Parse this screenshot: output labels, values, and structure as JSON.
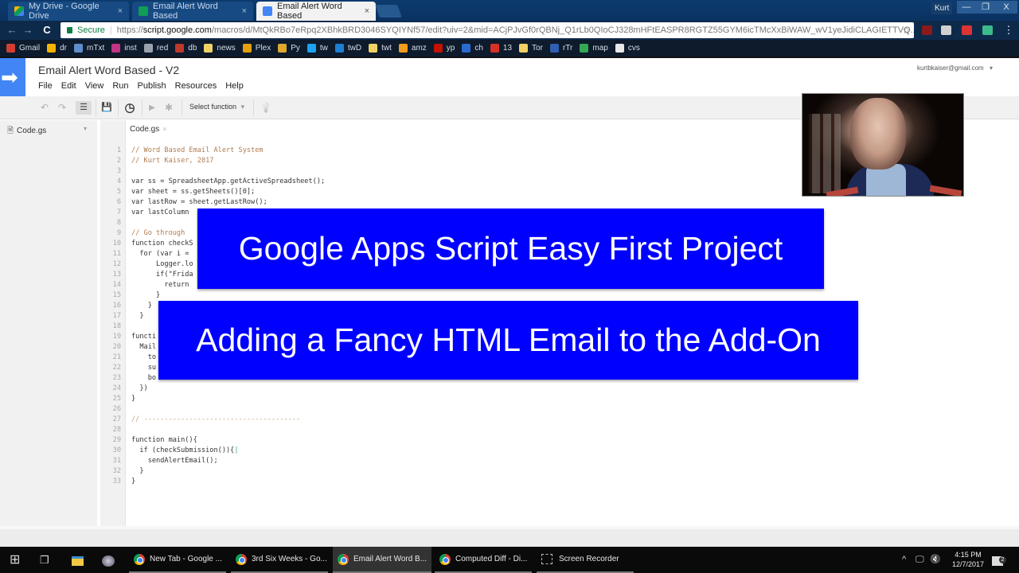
{
  "browser": {
    "tabs": [
      {
        "label": "My Drive - Google Drive",
        "icon": "google-drive-icon",
        "active": false
      },
      {
        "label": "Email Alert Word Based",
        "icon": "google-sheets-icon",
        "active": false
      },
      {
        "label": "Email Alert Word Based",
        "icon": "apps-script-icon",
        "active": true
      }
    ],
    "close_glyph": "×",
    "window_user": "Kurt",
    "window_controls": {
      "minimize": "—",
      "maximize": "❐",
      "close": "X"
    },
    "nav": {
      "back": "←",
      "forward": "→",
      "reload": "C"
    },
    "url": {
      "secure_label": "Secure",
      "scheme": "https://",
      "host": "script.google.com",
      "path": "/macros/d/MtQkRBo7eRpq2XBhkBRD3046SYQIYNf57/edit?uiv=2&mid=ACjPJvGf0rQBNj_Q1rLb0QIoCJ328mHFtEASPR8RGTZ55GYM6icTMcXxBiWAW_wV1yeJidiCLAGIETTVQ..."
    },
    "star": "☆",
    "menu_dots": "⋮",
    "bookmarks": [
      {
        "label": "Gmail",
        "color": "#d23f31"
      },
      {
        "label": "dr",
        "color": "#f4b400"
      },
      {
        "label": "mTxt",
        "color": "#5f8fc9"
      },
      {
        "label": "inst",
        "color": "#c13584"
      },
      {
        "label": "red",
        "color": "#9aa3ad"
      },
      {
        "label": "db",
        "color": "#c0392b"
      },
      {
        "label": "news",
        "color": "#f0d264"
      },
      {
        "label": "Plex",
        "color": "#e5a00d"
      },
      {
        "label": "Py",
        "color": "#e0a82e"
      },
      {
        "label": "tw",
        "color": "#1da1f2"
      },
      {
        "label": "twD",
        "color": "#1d7fd2"
      },
      {
        "label": "twt",
        "color": "#f0d264"
      },
      {
        "label": "amz",
        "color": "#f29b1d"
      },
      {
        "label": "yp",
        "color": "#c41200"
      },
      {
        "label": "ch",
        "color": "#2a6ad1"
      },
      {
        "label": "13",
        "color": "#d93025"
      },
      {
        "label": "Tor",
        "color": "#f0d264"
      },
      {
        "label": "rTr",
        "color": "#2f5fb3"
      },
      {
        "label": "map",
        "color": "#34a853"
      },
      {
        "label": "cvs",
        "color": "#e8e8e8"
      }
    ]
  },
  "app": {
    "title": "Email Alert Word Based - V2",
    "menu": [
      "File",
      "Edit",
      "View",
      "Run",
      "Publish",
      "Resources",
      "Help"
    ],
    "account": "kurtbkaiser@gmail.com",
    "account_caret": "▾",
    "toolbar": {
      "undo": "↶",
      "redo": "↷",
      "indent": "☰",
      "save": "💾",
      "triggers": "◷",
      "run": "▶",
      "debug": "✱",
      "select_function": "Select function",
      "select_caret": "▾",
      "lightbulb": "💡"
    },
    "sidebar": {
      "file": "Code.gs",
      "caret": "▾"
    },
    "editor_tab": {
      "label": "Code.gs",
      "close": "×"
    }
  },
  "code": {
    "line_numbers": [
      "1",
      "2",
      "3",
      "4",
      "5",
      "6",
      "7",
      "8",
      "9",
      "10",
      "11",
      "12",
      "13",
      "14",
      "15",
      "16",
      "17",
      "18",
      "19",
      "20",
      "21",
      "22",
      "23",
      "24",
      "25",
      "26",
      "27",
      "28",
      "29",
      "30",
      "31",
      "32",
      "33"
    ],
    "lines": [
      {
        "t": "// Word Based Email Alert System",
        "k": "c"
      },
      {
        "t": "// Kurt Kaiser, 2017",
        "k": "c"
      },
      {
        "t": "",
        "k": ""
      },
      {
        "t": "var ss = SpreadsheetApp.getActiveSpreadsheet();",
        "k": ""
      },
      {
        "t": "var sheet = ss.getSheets()[0];",
        "k": ""
      },
      {
        "t": "var lastRow = sheet.getLastRow();",
        "k": ""
      },
      {
        "t": "var lastColumn",
        "k": ""
      },
      {
        "t": "",
        "k": ""
      },
      {
        "t": "// Go through",
        "k": "c"
      },
      {
        "t": "function checkS",
        "k": ""
      },
      {
        "t": "  for (var i =",
        "k": ""
      },
      {
        "t": "      Logger.lo",
        "k": ""
      },
      {
        "t": "      if(\"Frida",
        "k": ""
      },
      {
        "t": "        return",
        "k": ""
      },
      {
        "t": "      }",
        "k": ""
      },
      {
        "t": "    }",
        "k": ""
      },
      {
        "t": "  }",
        "k": ""
      },
      {
        "t": "",
        "k": ""
      },
      {
        "t": "functi",
        "k": ""
      },
      {
        "t": "  Mail",
        "k": ""
      },
      {
        "t": "    to",
        "k": ""
      },
      {
        "t": "    su",
        "k": ""
      },
      {
        "t": "    bo",
        "k": ""
      },
      {
        "t": "  })",
        "k": ""
      },
      {
        "t": "}",
        "k": ""
      },
      {
        "t": "",
        "k": ""
      },
      {
        "t": "// --------------------------------------",
        "k": "dash"
      },
      {
        "t": "",
        "k": ""
      },
      {
        "t": "function main(){",
        "k": ""
      },
      {
        "t": "  if (checkSubmission()){",
        "k": "cur"
      },
      {
        "t": "    sendAlertEmail();",
        "k": ""
      },
      {
        "t": "  }",
        "k": ""
      },
      {
        "t": "}",
        "k": ""
      }
    ]
  },
  "overlay": {
    "title": "Google Apps Script Easy First Project",
    "subtitle": "Adding a Fancy HTML Email to the Add-On",
    "banner_color": "#0000ff"
  },
  "webcam": {
    "description": "presenter webcam feed"
  },
  "taskbar": {
    "start": "⊞",
    "task_view": "❐",
    "items": [
      {
        "label": "New Tab - Google ...",
        "active": false
      },
      {
        "label": "3rd Six Weeks - Go...",
        "active": false
      },
      {
        "label": "Email Alert Word B...",
        "active": true
      },
      {
        "label": "Computed Diff - Di...",
        "active": false
      },
      {
        "label": "Screen Recorder",
        "active": false
      }
    ],
    "tray": {
      "chevron": "^",
      "network": "🖵",
      "volume": "🔇"
    },
    "time": "4:15 PM",
    "date": "12/7/2017",
    "notifications": "2"
  }
}
